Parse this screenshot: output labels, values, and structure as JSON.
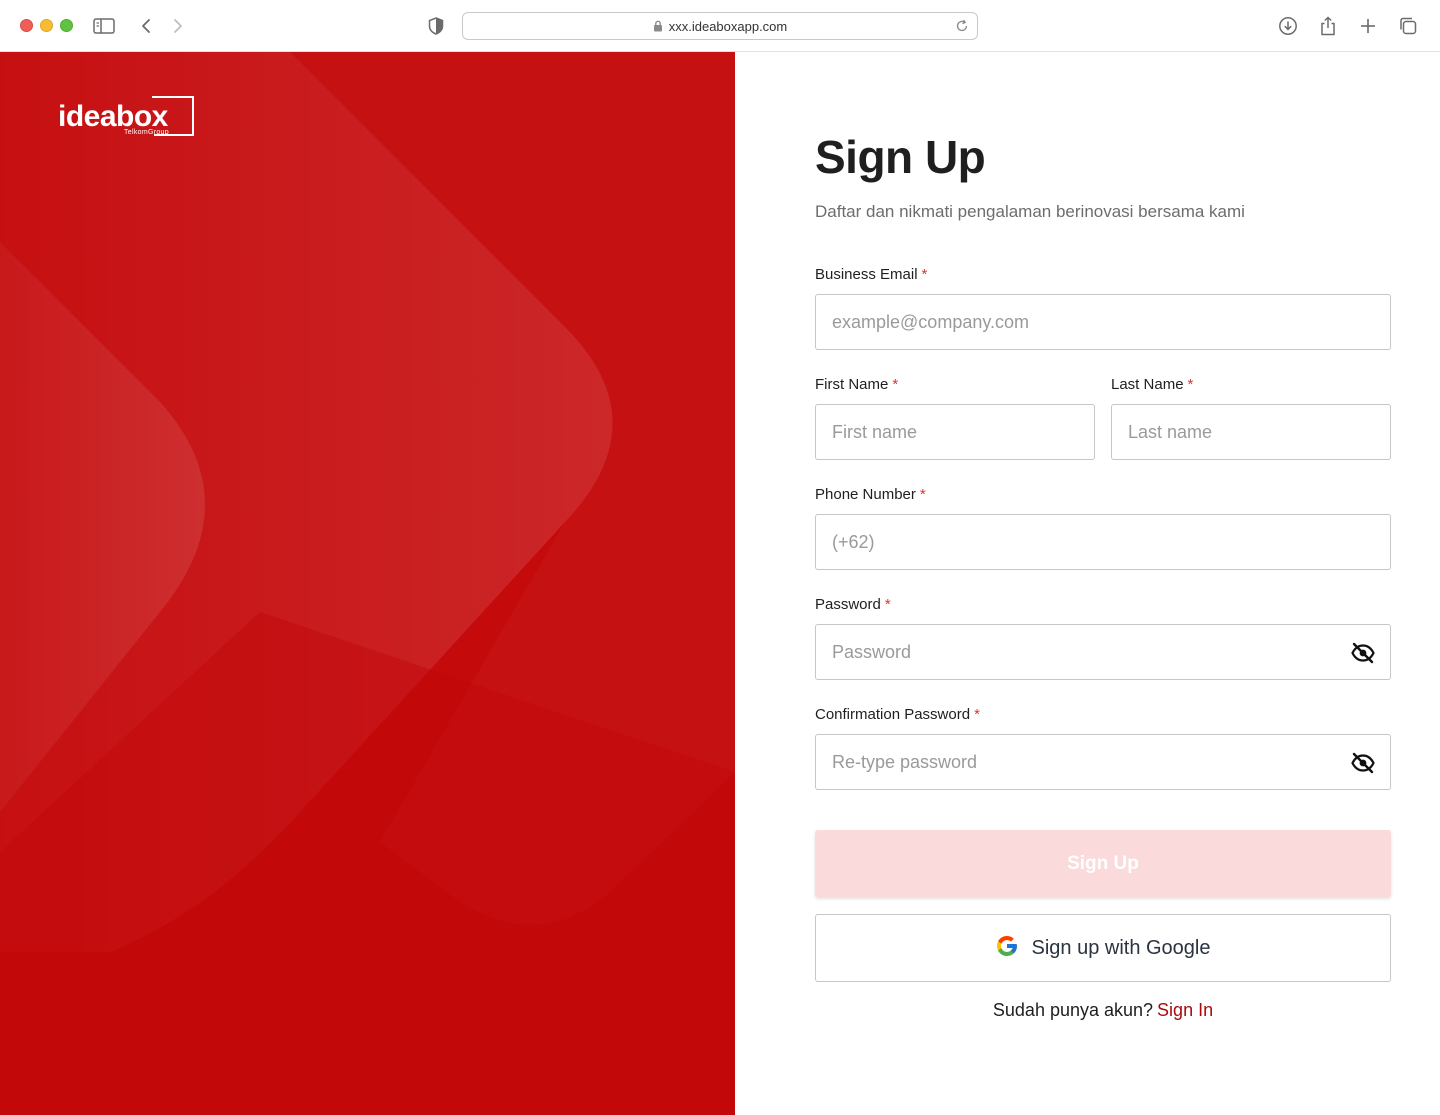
{
  "browser": {
    "url": "xxx.ideaboxapp.com"
  },
  "brand": {
    "name": "ideabox",
    "sub": "TelkomGroup",
    "color": "#c50a0c"
  },
  "form": {
    "title": "Sign Up",
    "subtitle": "Daftar dan nikmati pengalaman berinovasi bersama kami",
    "required_mark": "*",
    "email": {
      "label": "Business Email",
      "placeholder": "example@company.com",
      "value": ""
    },
    "first_name": {
      "label": "First Name",
      "placeholder": "First name",
      "value": ""
    },
    "last_name": {
      "label": "Last Name",
      "placeholder": "Last name",
      "value": ""
    },
    "phone": {
      "label": "Phone Number",
      "placeholder": "(+62)",
      "value": ""
    },
    "password": {
      "label": "Password",
      "placeholder": "Password",
      "value": ""
    },
    "confirm_password": {
      "label": "Confirmation Password",
      "placeholder": "Re-type password",
      "value": ""
    },
    "submit_label": "Sign Up",
    "google_label": "Sign up with Google",
    "footer_text": "Sudah punya akun?",
    "footer_link": "Sign In"
  },
  "icons": {
    "password_toggle": "eye-off-icon",
    "google": "google-icon"
  }
}
